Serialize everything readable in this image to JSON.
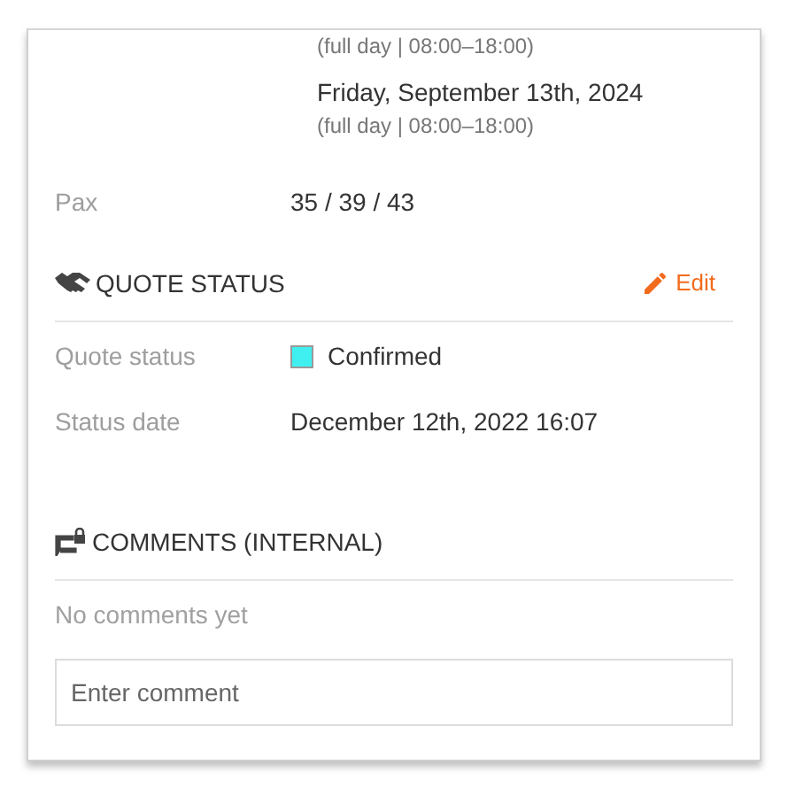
{
  "dates": [
    {
      "note": "(full day | 08:00–18:00)"
    },
    {
      "date": "Friday, September 13th, 2024",
      "note": "(full day | 08:00–18:00)"
    }
  ],
  "pax": {
    "label": "Pax",
    "value": "35 / 39 / 43"
  },
  "quote_status": {
    "title": "QUOTE STATUS",
    "edit": "Edit",
    "fields": [
      {
        "kind": "status",
        "label": "Quote status",
        "value": "Confirmed",
        "color": "#40f0f0"
      },
      {
        "kind": "text",
        "label": "Status date",
        "value": "December 12th, 2022 16:07"
      }
    ]
  },
  "comments": {
    "title": "COMMENTS (INTERNAL)",
    "empty": "No comments yet",
    "placeholder": "Enter comment"
  }
}
